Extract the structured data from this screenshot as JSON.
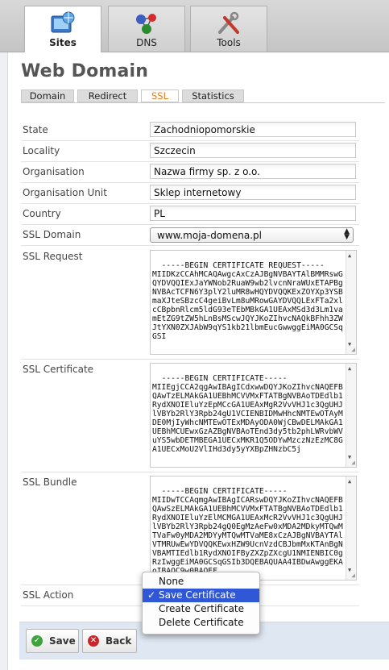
{
  "top_tabs": [
    {
      "label": "Sites",
      "icon": "sites-globe-icon",
      "active": true
    },
    {
      "label": "DNS",
      "icon": "dns-network-icon",
      "active": false
    },
    {
      "label": "Tools",
      "icon": "tools-wrench-icon",
      "active": false
    }
  ],
  "page_title": "Web Domain",
  "sub_tabs": [
    {
      "label": "Domain",
      "active": false
    },
    {
      "label": "Redirect",
      "active": false
    },
    {
      "label": "SSL",
      "active": true
    },
    {
      "label": "Statistics",
      "active": false
    }
  ],
  "form": {
    "state": {
      "label": "State",
      "value": "Zachodniopomorskie"
    },
    "locality": {
      "label": "Locality",
      "value": "Szczecin"
    },
    "organisation": {
      "label": "Organisation",
      "value": "Nazwa firmy sp. z o.o."
    },
    "organisation_unit": {
      "label": "Organisation Unit",
      "value": "Sklep internetowy"
    },
    "country": {
      "label": "Country",
      "value": "PL"
    },
    "ssl_domain": {
      "label": "SSL Domain",
      "value": "www.moja-domena.pl"
    },
    "ssl_request": {
      "label": "SSL Request",
      "value": "-----BEGIN CERTIFICATE REQUEST-----\nMIIDKzCCAhMCAQAwgcAxCzAJBgNVBAYTAlBMMRswGQYDVQQIExJaYWNob2RuaW9wb2lvcnNraWUxETAPBgNVBAcTCFN6Y3plY2luMR8wHQYDVQQKExZOYXp3YSBmaXJteSBzcC4geiBvLm8uMRowGAYDVQQLExFTa2xlcCBpbnRlcm5ldG93eTEbMBkGA1UEAxMSd3d3Lm1vamEtZG9tZW5hLnBsMScwJQYJKoZIhvcNAQkBFhh3ZWJtYXN0ZXJAbW9qYS1kb21lbmEucGwwggEiMA0GCSqGSI"
    },
    "ssl_certificate": {
      "label": "SSL Certificate",
      "value": "-----BEGIN CERTIFICATE-----\nMIIEgjCCA2qgAwIBAgICdxwwDQYJKoZIhvcNAQEFBQAwTzELMAkGA1UEBhMCVVMxFTATBgNVBAoTDEdlb1RydXNOIEluYzEpMCcGA1UEAxMgR2VvVHJ1c3QgUHJlVBYb2RlY3Rpb24gU1VCIENBIDMwHhcNMTEwOTAyMDE0MjIyWhcNMTEwOTExMDAyODA0WjCBwDELMAkGA1UEBhMCUEwxGzAZBgNVBAoTEnd3dy5tb2phLWRvbWVuYS5wbDETMBEGA1UECxMKR1Q5ODYwMzczNzEzMC8GA1UECxMoU2VlIHd3dy5yYXBpZHNzbC5j"
    },
    "ssl_bundle": {
      "label": "SSL Bundle",
      "value": "-----BEGIN CERTIFICATE-----\nMIIDwTCCAqmgAwIBAgICARswDQYJKoZIhvcNAQEFBQAwSzELMAkGA1UEBhMCVVMxFTATBgNVBAoTDEdlb1RydXNOIEluYzElMCMGA1UEAxMcR2VvVHJ1c3QgUHJlVBYb2RlY3Rpb24gQ0EgMzAeFw0xMDA2MDkyMTQwMTVaFw0yMDA2MDYyMTQwMTVaME8xCzAJBgNVBAYTAlVTMRUwEwYDVQQKEwxHZW9UcnVzdCBJbmMxKTAnBgNVBAMTIEdlb1RydXNOIFByZXZpZXcgU1NMIENBIC0gRzIwggEiMA0GCSqGSIb3DQEBAQUAA4IBDwAwggEKAoIBAQC9w0BAQEF"
    },
    "ssl_action": {
      "label": "SSL Action"
    }
  },
  "ssl_action_menu": {
    "options": [
      "None",
      "Save Certificate",
      "Create Certificate",
      "Delete Certificate"
    ],
    "selected": "Save Certificate",
    "check_glyph": "✓"
  },
  "buttons": {
    "save": {
      "label": "Save",
      "icon": "check-icon",
      "color": "#3da33a"
    },
    "back": {
      "label": "Back",
      "icon": "cancel-x-icon",
      "color": "#c8262a"
    }
  },
  "colors": {
    "active_subtab_text": "#e37c10",
    "menu_highlight": "#2f57d6",
    "action_bar": "#dfe7f2"
  }
}
